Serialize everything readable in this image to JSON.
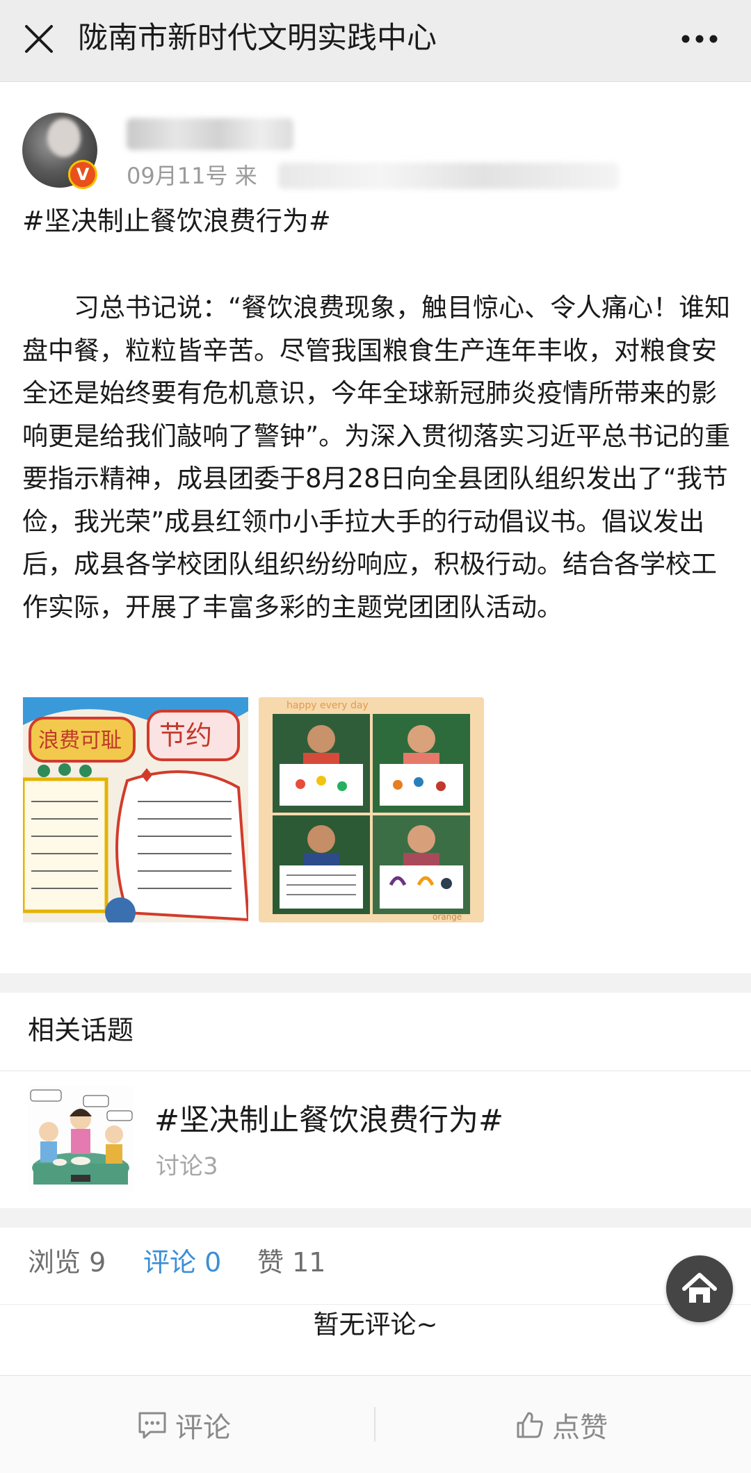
{
  "nav": {
    "title": "陇南市新时代文明实践中心",
    "close_icon": "close-icon",
    "more_icon": "more-icon"
  },
  "post": {
    "date": "09月11号 来",
    "topic": "#坚决制止餐饮浪费行为#",
    "body": "习总书记说：“餐饮浪费现象，触目惊心、令人痛心！谁知盘中餐，粒粒皆辛苦。尽管我国粮食生产连年丰收，对粮食安全还是始终要有危机意识，今年全球新冠肺炎疫情所带来的影响更是给我们敲响了警钟”。为深入贯彻落实习近平总书记的重要指示精神，成县团委于8月28日向全县团队组织发出了“我节俭，我光荣”成县红领巾小手拉大手的行动倡议书。倡议发出后，成县各学校团队组织纷纷响应，积极行动。结合各学校工作实际，开展了丰富多彩的主题党团团队活动。",
    "photo1_text": "浪费可耻 节约",
    "photo2_caption": "happy every day",
    "photo2_footer": "orange",
    "verified_badge": "V"
  },
  "related": {
    "title": "相关话题",
    "topic_name": "#坚决制止餐饮浪费行为#",
    "topic_count": "讨论3"
  },
  "stats": {
    "views": "浏览 9",
    "comments": "评论 0",
    "likes": "赞 11",
    "empty": "暂无评论~"
  },
  "toolbar": {
    "comment_label": "评论",
    "like_label": "点赞"
  },
  "colors": {
    "accent": "#3b8fd6",
    "navbar_bg": "#ededed",
    "badge": "#e8501c"
  }
}
